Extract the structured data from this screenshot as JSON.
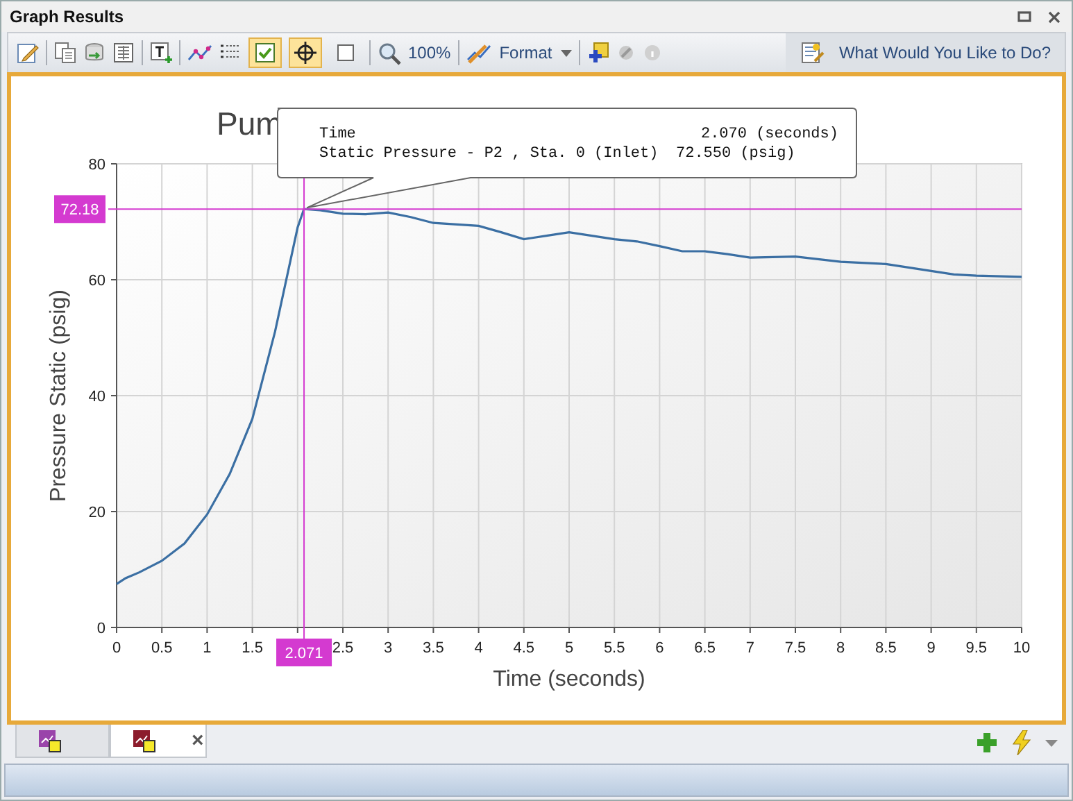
{
  "window": {
    "title": "Graph Results"
  },
  "toolbar": {
    "toggles": [
      {
        "kind": "checkbox",
        "on": true
      },
      {
        "kind": "crosshair",
        "on": true
      },
      {
        "kind": "square",
        "on": false
      }
    ],
    "zoom": "100%",
    "format": "Format",
    "help": "What Would You Like to Do?"
  },
  "graph": {
    "chart_data": {
      "type": "line",
      "title": "Pum",
      "xlabel": "Time (seconds)",
      "ylabel": "Pressure Static (psig)",
      "xlim": [
        0,
        10
      ],
      "ylim": [
        0,
        80
      ],
      "xticks": [
        0,
        0.5,
        1,
        1.5,
        2.5,
        3,
        3.5,
        4,
        4.5,
        5,
        5.5,
        6,
        6.5,
        7,
        7.5,
        8,
        8.5,
        9,
        9.5,
        10
      ],
      "yticks": [
        0,
        20,
        40,
        60,
        80
      ],
      "x": [
        0,
        0.1,
        0.25,
        0.5,
        0.75,
        1,
        1.25,
        1.5,
        1.75,
        2,
        2.07,
        2.25,
        2.5,
        2.75,
        3,
        3.25,
        3.5,
        4,
        4.25,
        4.5,
        4.75,
        5,
        5.25,
        5.5,
        5.75,
        6,
        6.25,
        6.5,
        6.75,
        7,
        7.5,
        8,
        8.5,
        9,
        9.25,
        9.5,
        10
      ],
      "series": [
        {
          "color": "#3b6fa3",
          "values": [
            7.5,
            8.5,
            9.5,
            11.5,
            14.5,
            19.5,
            26.5,
            36,
            51,
            69,
            72.2,
            72,
            71.4,
            71.3,
            71.6,
            70.8,
            69.8,
            69.3,
            68.2,
            67,
            67.6,
            68.2,
            67.6,
            67,
            66.6,
            65.8,
            64.9,
            64.9,
            64.4,
            63.8,
            64,
            63.1,
            62.7,
            61.5,
            60.9,
            60.7,
            60.5
          ]
        }
      ],
      "grid": true,
      "ref_lines": [
        {
          "axis": "x",
          "value": 2.071,
          "label": "2.071",
          "color": "#d43ad0"
        },
        {
          "axis": "y",
          "value": 72.18,
          "label": "72.18",
          "color": "#d43ad0"
        }
      ]
    },
    "tooltip": {
      "rows": [
        {
          "label": "Time",
          "value": "2.070 (seconds)"
        },
        {
          "label": "Static Pressure - P2 , Sta. 0 (Inlet)",
          "value": "72.550 (psig)"
        }
      ]
    }
  },
  "tabs": [
    {
      "selected": false,
      "color": "#9a44aa"
    },
    {
      "selected": true,
      "color": "#8c1c2c",
      "close": "×"
    }
  ]
}
